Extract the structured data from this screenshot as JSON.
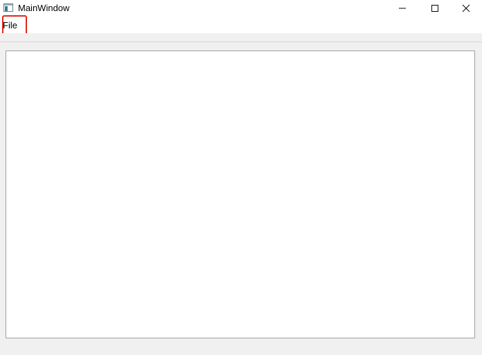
{
  "window": {
    "title": "MainWindow",
    "icon": "app-window-icon"
  },
  "caption_buttons": {
    "minimize_icon": "minimize-icon",
    "maximize_icon": "maximize-icon",
    "close_icon": "close-icon"
  },
  "menubar": {
    "items": [
      {
        "label": "File"
      }
    ]
  },
  "colors": {
    "highlight": "#e0281a",
    "background": "#f0f0f0",
    "content": "#ffffff"
  }
}
